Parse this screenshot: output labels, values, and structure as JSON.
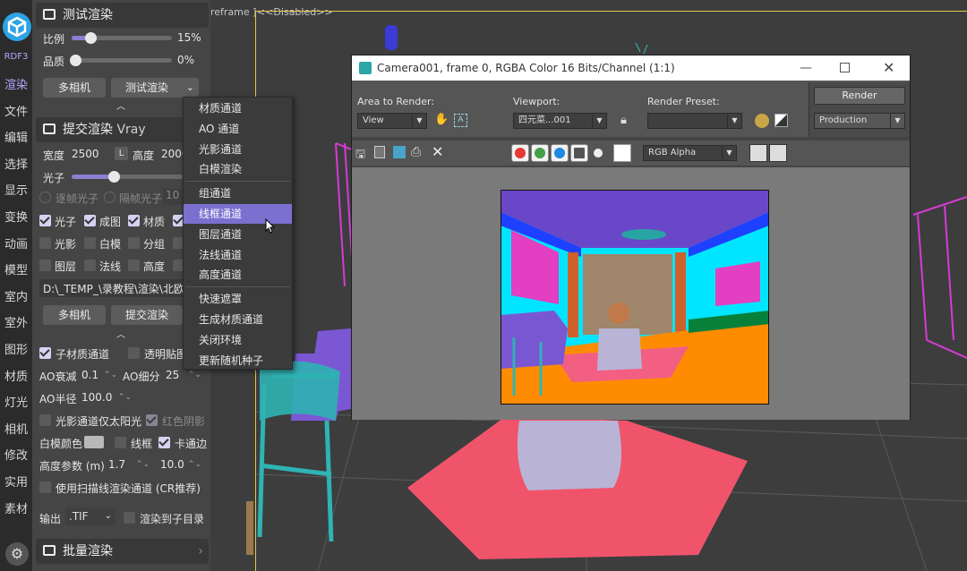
{
  "viewport": {
    "label_left": "reframe ]",
    "label_right": "<<Disabled>>"
  },
  "iconbar": {
    "logo_label": "RDF3",
    "items": [
      "渲染",
      "文件",
      "编辑",
      "选择",
      "显示",
      "变换",
      "动画",
      "模型",
      "室内",
      "室外",
      "图形",
      "材质",
      "灯光",
      "相机",
      "修改",
      "实用",
      "素材"
    ],
    "active_index": 0
  },
  "test_render": {
    "title": "测试渲染",
    "scale_label": "比例",
    "scale_value": "15%",
    "scale_fraction": 0.15,
    "quality_label": "品质",
    "quality_value": "0%",
    "quality_fraction": 0.0,
    "multi_camera": "多相机",
    "test_render_btn": "测试渲染"
  },
  "submit_render": {
    "title": "提交渲染",
    "engine": "Vray",
    "width_label": "宽度",
    "width_value": "2500",
    "lock_label": "L",
    "height_label": "高度",
    "height_value": "2000",
    "photon_label": "光子",
    "photon_fraction": 0.35,
    "radio_a": "逐帧光子",
    "radio_b": "隔帧光子",
    "radio_b_value": "10",
    "checks": [
      {
        "label": "光子",
        "on": true
      },
      {
        "label": "成图",
        "on": true
      },
      {
        "label": "材质",
        "on": true
      },
      {
        "label": "",
        "on": true
      },
      {
        "label": "光影",
        "on": false
      },
      {
        "label": "白模",
        "on": false
      },
      {
        "label": "分组",
        "on": false
      },
      {
        "label": "",
        "on": false
      },
      {
        "label": "图层",
        "on": false
      },
      {
        "label": "法线",
        "on": false
      },
      {
        "label": "高度",
        "on": false
      },
      {
        "label": "",
        "on": false
      }
    ],
    "path": "D:\\_TEMP_\\录教程\\渲染\\北欧",
    "multi_camera": "多相机",
    "submit_btn": "提交渲染"
  },
  "options": {
    "sub_material": "子材质通道",
    "sub_material_on": true,
    "transparent_map": "透明贴图",
    "transparent_map_on": false,
    "ao_decay_label": "AO衰减",
    "ao_decay_value": "0.1",
    "ao_subdiv_label": "AO细分",
    "ao_subdiv_value": "25",
    "ao_radius_label": "AO半径",
    "ao_radius_value": "100.0",
    "light_only_sun": "光影通道仅太阳光",
    "red_shadow": "红色阴影",
    "red_shadow_on": true,
    "model_color_label": "白模颜色",
    "wireframe": "线框",
    "card_edge": "卡通边",
    "card_edge_on": true,
    "height_param_label": "高度参数 (m)",
    "height_min": "1.7",
    "height_max": "10.0",
    "scanline": "使用扫描线渲染通道 (CR推荐)",
    "output_label": "输出",
    "output_format": ".TIF",
    "render_to_subdir": "渲染到子目录"
  },
  "batch_render": {
    "title": "批量渲染"
  },
  "menu": {
    "items": [
      "材质通道",
      "AO 通道",
      "光影通道",
      "白模渲染",
      "组通道",
      "线框通道",
      "图层通道",
      "法线通道",
      "高度通道",
      "快速遮罩",
      "生成材质通道",
      "关闭环境",
      "更新随机种子"
    ],
    "highlighted_index": 5
  },
  "render_window": {
    "title": "Camera001, frame 0, RGBA Color 16 Bits/Channel (1:1)",
    "area_label": "Area to Render:",
    "area_value": "View",
    "viewport_label": "Viewport:",
    "viewport_value": "四元菜...001",
    "preset_label": "Render Preset:",
    "preset_value": "",
    "render_btn": "Render",
    "production_value": "Production",
    "channel_value": "RGB Alpha",
    "colors": {
      "red": "#e53935",
      "green": "#43a047",
      "blue": "#1e88e5"
    }
  }
}
